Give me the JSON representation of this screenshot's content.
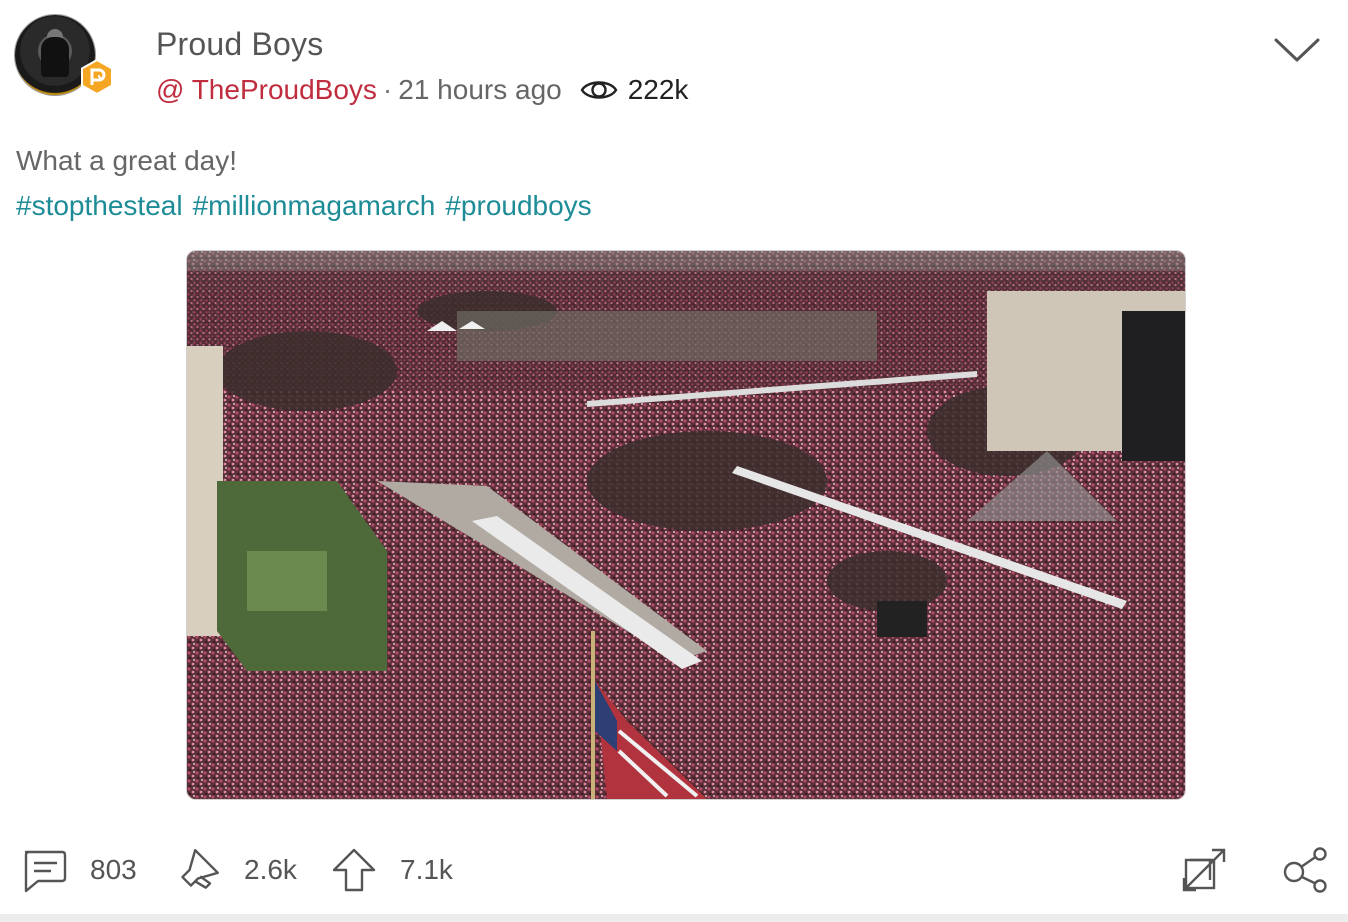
{
  "post": {
    "author": {
      "name": "Proud Boys",
      "handle": "@ TheProudBoys",
      "avatar_icon": "proud-boys-seal-avatar",
      "badge_icon": "parler-p-badge",
      "badge_color": "#f5a623"
    },
    "time_ago": "21 hours ago",
    "separator": "·",
    "views": "222k",
    "text": "What a great day!",
    "hashtags": [
      "#stopthesteal",
      "#millionmagamarch",
      "#proudboys"
    ],
    "media": {
      "kind": "photo",
      "description_icon": "crowd-aerial-photo"
    },
    "actions": {
      "comments": "803",
      "echoes": "2.6k",
      "upvotes": "7.1k"
    }
  },
  "colors": {
    "handle": "#c02d3e",
    "hashtag": "#1e8c97",
    "text": "#666666"
  }
}
